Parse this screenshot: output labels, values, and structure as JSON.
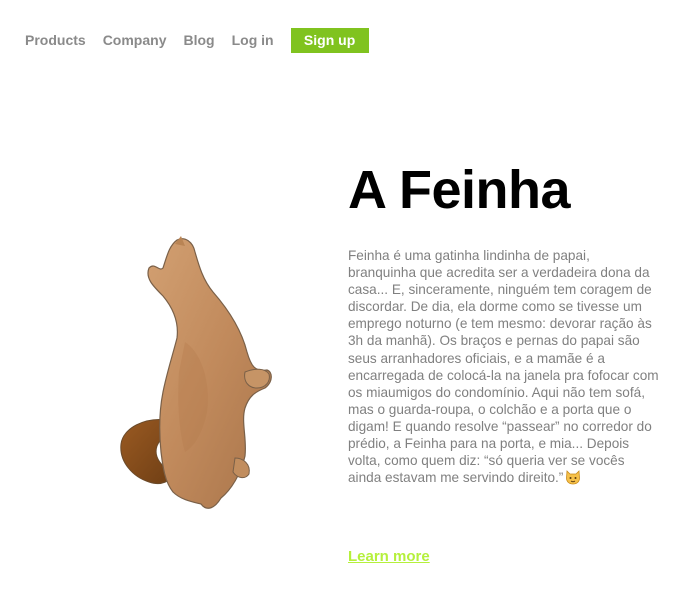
{
  "nav": {
    "items": [
      {
        "label": "Products"
      },
      {
        "label": "Company"
      },
      {
        "label": "Blog"
      },
      {
        "label": "Log in"
      }
    ],
    "signup_label": "Sign up"
  },
  "hero": {
    "title": "A Feinha",
    "description": "Feinha é uma gatinha lindinha de papai, branquinha que acredita ser a verdadeira dona da casa... E, sinceramente, ninguém tem coragem de discordar. De dia, ela dorme como se tivesse um emprego noturno (e tem mesmo: devorar ração às 3h da manhã). Os braços e pernas do papai são seus arranhadores oficiais, e a mamãe é a encarregada de colocá-la na janela pra fofocar com os miaumigos do condomínio. Aqui não tem sofá, mas o guarda-roupa, o colchão e a porta que o digam! E quando resolve “passear” no corredor do prédio, a Feinha para na porta, e mia... Depois volta, como quem diz: “só queria ver se vocês ainda estavam me servindo direito.”",
    "emoji": "cat-face-icon",
    "learn_more_label": "Learn more"
  },
  "colors": {
    "accent": "#80c31f",
    "link": "#b5f03c",
    "nav_text": "#8a8a8a",
    "body_text": "#808080"
  }
}
